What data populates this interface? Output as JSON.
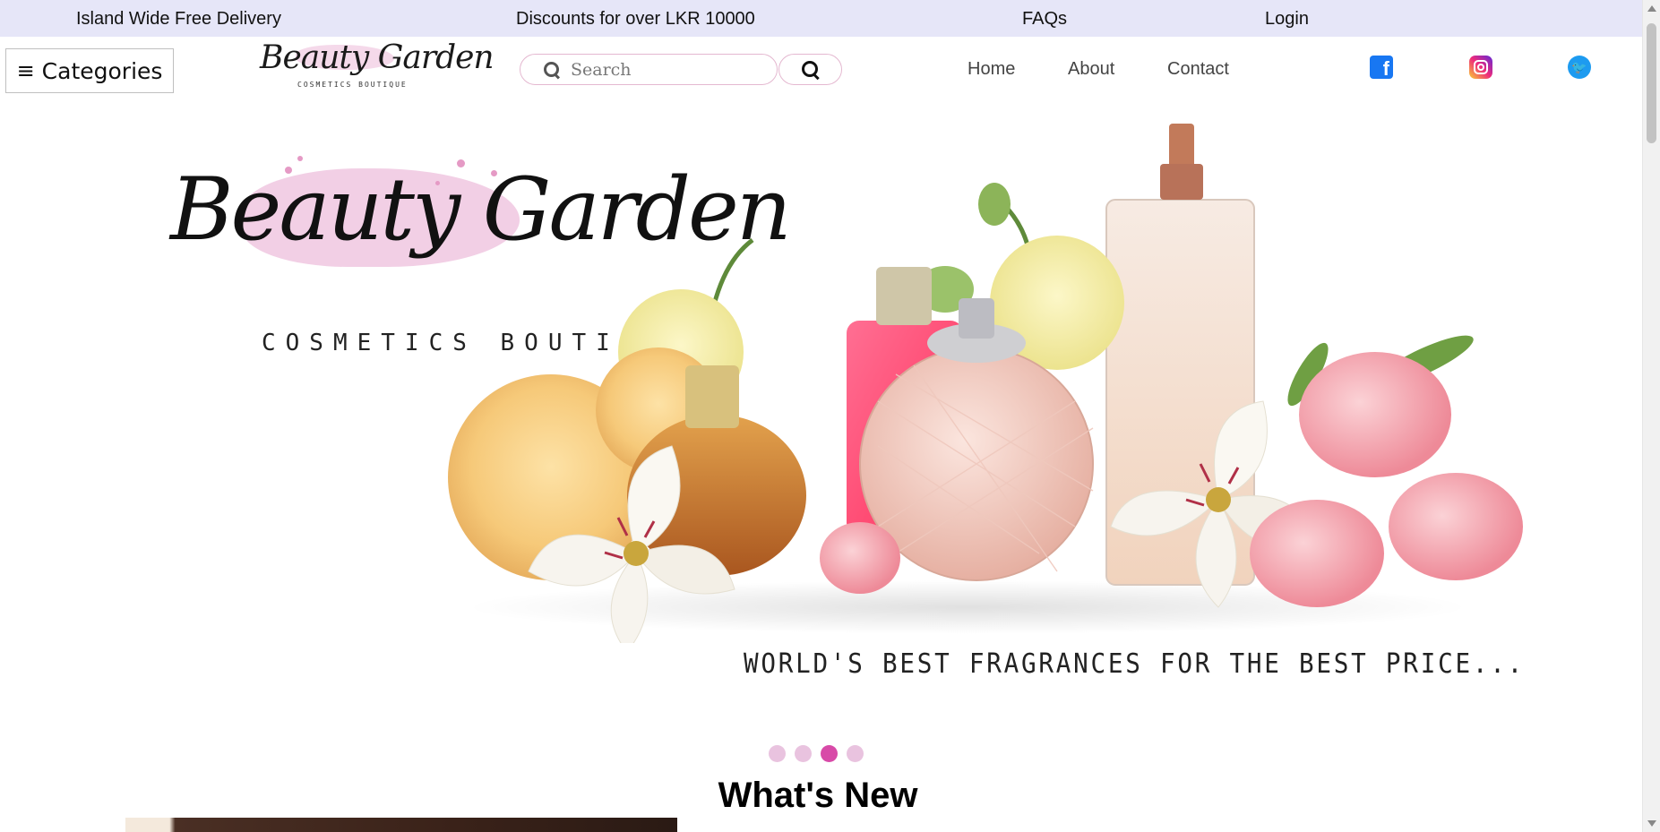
{
  "topbar": {
    "delivery": "Island Wide Free Delivery",
    "discount": "Discounts for over LKR 10000",
    "faqs": "FAQs",
    "login": "Login"
  },
  "header": {
    "menu_icon": "≡",
    "categories_label": "Categories",
    "logo_script": "Beauty Garden",
    "logo_sub": "COSMETICS BOUTIQUE",
    "search_placeholder": "Search",
    "nav": {
      "home": "Home",
      "about": "About",
      "contact": "Contact"
    },
    "social": [
      "facebook-icon",
      "instagram-icon",
      "twitter-icon"
    ],
    "fb_glyph": "f",
    "tw_glyph": "🐦"
  },
  "hero": {
    "logo_script": "Beauty Garden",
    "logo_sub": "COSMETICS BOUTIQUE",
    "tagline": "WORLD'S BEST FRAGRANCES FOR THE BEST PRICE...",
    "slide_count": 4,
    "active_slide": 3
  },
  "section": {
    "title": "What's New"
  },
  "colors": {
    "topbar_bg": "#e6e6f8",
    "accent_pink": "#d84aa8",
    "dot_inactive": "#e9c3df",
    "facebook": "#1877f2",
    "twitter": "#1d9bf0"
  }
}
